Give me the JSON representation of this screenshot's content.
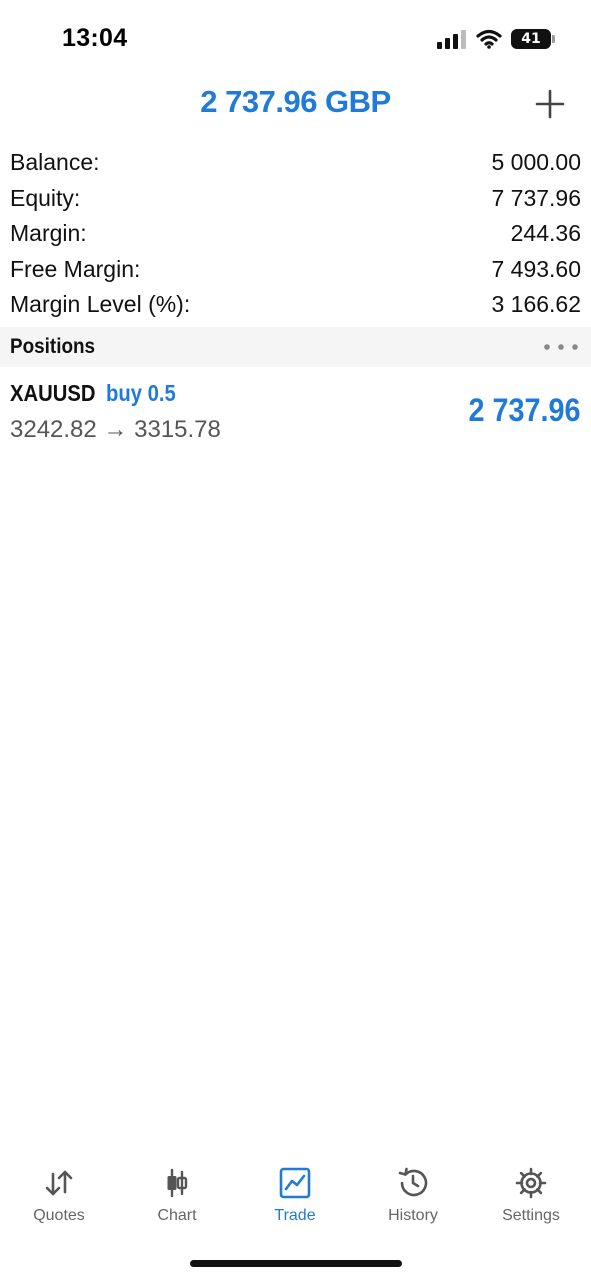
{
  "status_bar": {
    "time": "13:04",
    "battery": "41",
    "icons": [
      "cellular-signal-icon",
      "wifi-icon",
      "battery-icon"
    ]
  },
  "header": {
    "title": "2 737.96 GBP",
    "add_icon": "plus-icon"
  },
  "summary": {
    "balance_label": "Balance:",
    "balance_value": "5 000.00",
    "equity_label": "Equity:",
    "equity_value": "7 737.96",
    "margin_label": "Margin:",
    "margin_value": "244.36",
    "free_margin_label": "Free Margin:",
    "free_margin_value": "7 493.60",
    "margin_level_label": "Margin Level (%):",
    "margin_level_value": "3 166.62"
  },
  "positions": {
    "title": "Positions",
    "more_icon": "more-horizontal-icon",
    "items": [
      {
        "symbol": "XAUUSD",
        "type": "buy 0.5",
        "prices": "3242.82 → 3315.78",
        "profit": "2 737.96"
      }
    ]
  },
  "tabs": [
    {
      "label": "Quotes",
      "icon": "quotes-arrows-icon",
      "active": false
    },
    {
      "label": "Chart",
      "icon": "candlestick-chart-icon",
      "active": false
    },
    {
      "label": "Trade",
      "icon": "trade-chart-icon",
      "active": true
    },
    {
      "label": "History",
      "icon": "history-clock-icon",
      "active": false
    },
    {
      "label": "Settings",
      "icon": "gear-icon",
      "active": false
    }
  ],
  "colors": {
    "accent": "#1f7ad8",
    "text": "#111111",
    "secondary_text": "#555555",
    "section_background": "#f5f5f5",
    "inactive_tab": "#666666"
  }
}
